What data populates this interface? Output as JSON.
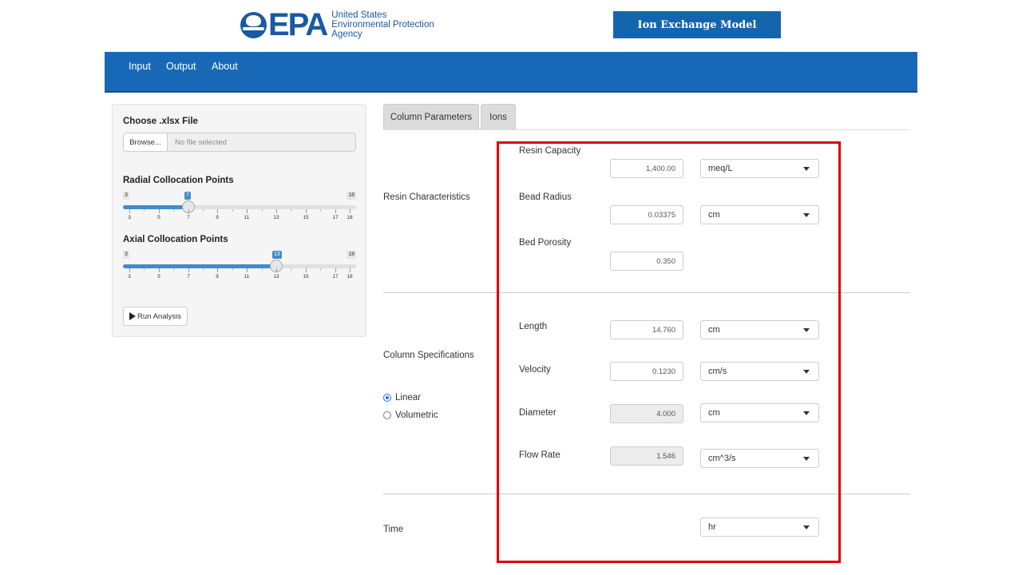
{
  "header": {
    "logo_text": "EPA",
    "logo_lines": [
      "United States",
      "Environmental Protection",
      "Agency"
    ],
    "model_title": "Ion Exchange Model"
  },
  "nav": [
    "Input",
    "Output",
    "About"
  ],
  "sidebar": {
    "file_label": "Choose .xlsx File",
    "browse_label": "Browse...",
    "file_placeholder": "No file selected",
    "radial": {
      "label": "Radial Collocation Points",
      "min": 3,
      "max": 18,
      "value": 7,
      "tick_labels": [
        "3",
        "5",
        "7",
        "9",
        "11",
        "13",
        "15",
        "17",
        "18"
      ]
    },
    "axial": {
      "label": "Axial Collocation Points",
      "min": 3,
      "max": 18,
      "value": 13,
      "tick_labels": [
        "3",
        "5",
        "7",
        "9",
        "11",
        "13",
        "15",
        "17",
        "18"
      ]
    },
    "run_label": "Run Analysis"
  },
  "tabs": [
    "Column Parameters",
    "Ions"
  ],
  "resin": {
    "section": "Resin Characteristics",
    "capacity": {
      "label": "Resin Capacity",
      "value": "1,400.00",
      "unit": "meq/L"
    },
    "radius": {
      "label": "Bead Radius",
      "value": "0.03375",
      "unit": "cm"
    },
    "porosity": {
      "label": "Bed Porosity",
      "value": "0.350"
    }
  },
  "column": {
    "section": "Column Specifications",
    "radio_linear": "Linear",
    "radio_volumetric": "Volumetric",
    "length": {
      "label": "Length",
      "value": "14.760",
      "unit": "cm"
    },
    "velocity": {
      "label": "Velocity",
      "value": "0.1230",
      "unit": "cm/s"
    },
    "diameter": {
      "label": "Diameter",
      "value": "4.000",
      "unit": "cm"
    },
    "flow_rate": {
      "label": "Flow Rate",
      "value": "1.546",
      "unit": "cm^3/s"
    }
  },
  "time": {
    "section": "Time",
    "unit": "hr"
  },
  "colors": {
    "brand_blue": "#1769b8",
    "slider_blue": "#428bca",
    "highlight_red": "#e00000"
  }
}
